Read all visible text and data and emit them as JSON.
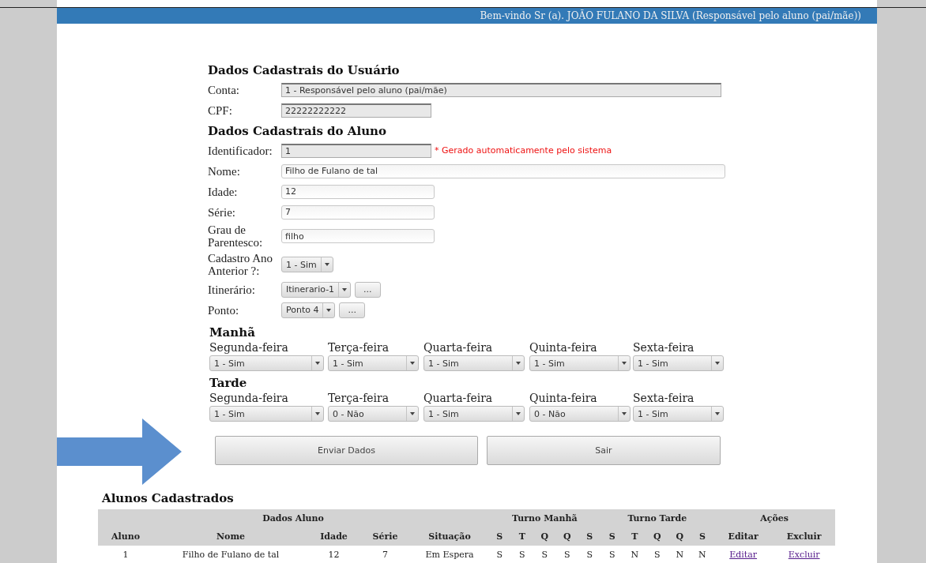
{
  "header": {
    "welcome": "Bem-vindo Sr (a). JOÃO FULANO DA SILVA (Responsável pelo aluno (pai/mãe))"
  },
  "user_section": {
    "title": "Dados Cadastrais do Usuário",
    "fields": [
      {
        "kind": "readonly_long",
        "label": "Conta:",
        "value": "1 - Responsável pelo aluno (pai/mãe)"
      },
      {
        "kind": "readonly",
        "label": "CPF:",
        "value": "22222222222"
      }
    ]
  },
  "student_section": {
    "title": "Dados Cadastrais do Aluno",
    "fields": [
      {
        "kind": "readonly",
        "label": "Identificador:",
        "value": "1",
        "note": "* Gerado automaticamente pelo sistema"
      },
      {
        "kind": "text_long",
        "label": "Nome:",
        "value": "Filho de Fulano de tal"
      },
      {
        "kind": "text",
        "label": "Idade:",
        "value": "12"
      },
      {
        "kind": "text",
        "label": "Série:",
        "value": "7"
      },
      {
        "kind": "text",
        "label": "Grau de Parentesco:",
        "value": "filho"
      },
      {
        "kind": "select",
        "label": "Cadastro Ano Anterior ?:",
        "value": "1 - Sim"
      },
      {
        "kind": "select",
        "label": "Itinerário:",
        "value": "Itinerario-1",
        "extra_button": "..."
      },
      {
        "kind": "select",
        "label": "Ponto:",
        "value": "Ponto 4",
        "extra_button": "..."
      }
    ]
  },
  "schedule": [
    {
      "title": "Manhã",
      "days": [
        {
          "label": "Segunda-feira",
          "value": "1 - Sim"
        },
        {
          "label": "Terça-feira",
          "value": "1 - Sim"
        },
        {
          "label": "Quarta-feira",
          "value": "1 - Sim"
        },
        {
          "label": "Quinta-feira",
          "value": "1 - Sim"
        },
        {
          "label": "Sexta-feira",
          "value": "1 - Sim"
        }
      ]
    },
    {
      "title": "Tarde",
      "days": [
        {
          "label": "Segunda-feira",
          "value": "1 - Sim"
        },
        {
          "label": "Terça-feira",
          "value": "0 - Não"
        },
        {
          "label": "Quarta-feira",
          "value": "1 - Sim"
        },
        {
          "label": "Quinta-feira",
          "value": "0 - Não"
        },
        {
          "label": "Sexta-feira",
          "value": "1 - Sim"
        }
      ]
    }
  ],
  "buttons": [
    "Enviar Dados",
    "Sair"
  ],
  "table": {
    "title": "Alunos Cadastrados",
    "groups": [
      "Dados Aluno",
      "Turno Manhã",
      "Turno Tarde",
      "Ações"
    ],
    "columns": [
      "Aluno",
      "Nome",
      "Idade",
      "Série",
      "Situação",
      "S",
      "T",
      "Q",
      "Q",
      "S",
      "S",
      "T",
      "Q",
      "Q",
      "S",
      "Editar",
      "Excluir"
    ],
    "rows": [
      {
        "cells": [
          "1",
          "Filho de Fulano de tal",
          "12",
          "7",
          "Em Espera",
          "S",
          "S",
          "S",
          "S",
          "S",
          "S",
          "N",
          "S",
          "N",
          "N"
        ],
        "links": [
          "Editar",
          "Excluir"
        ]
      }
    ]
  }
}
